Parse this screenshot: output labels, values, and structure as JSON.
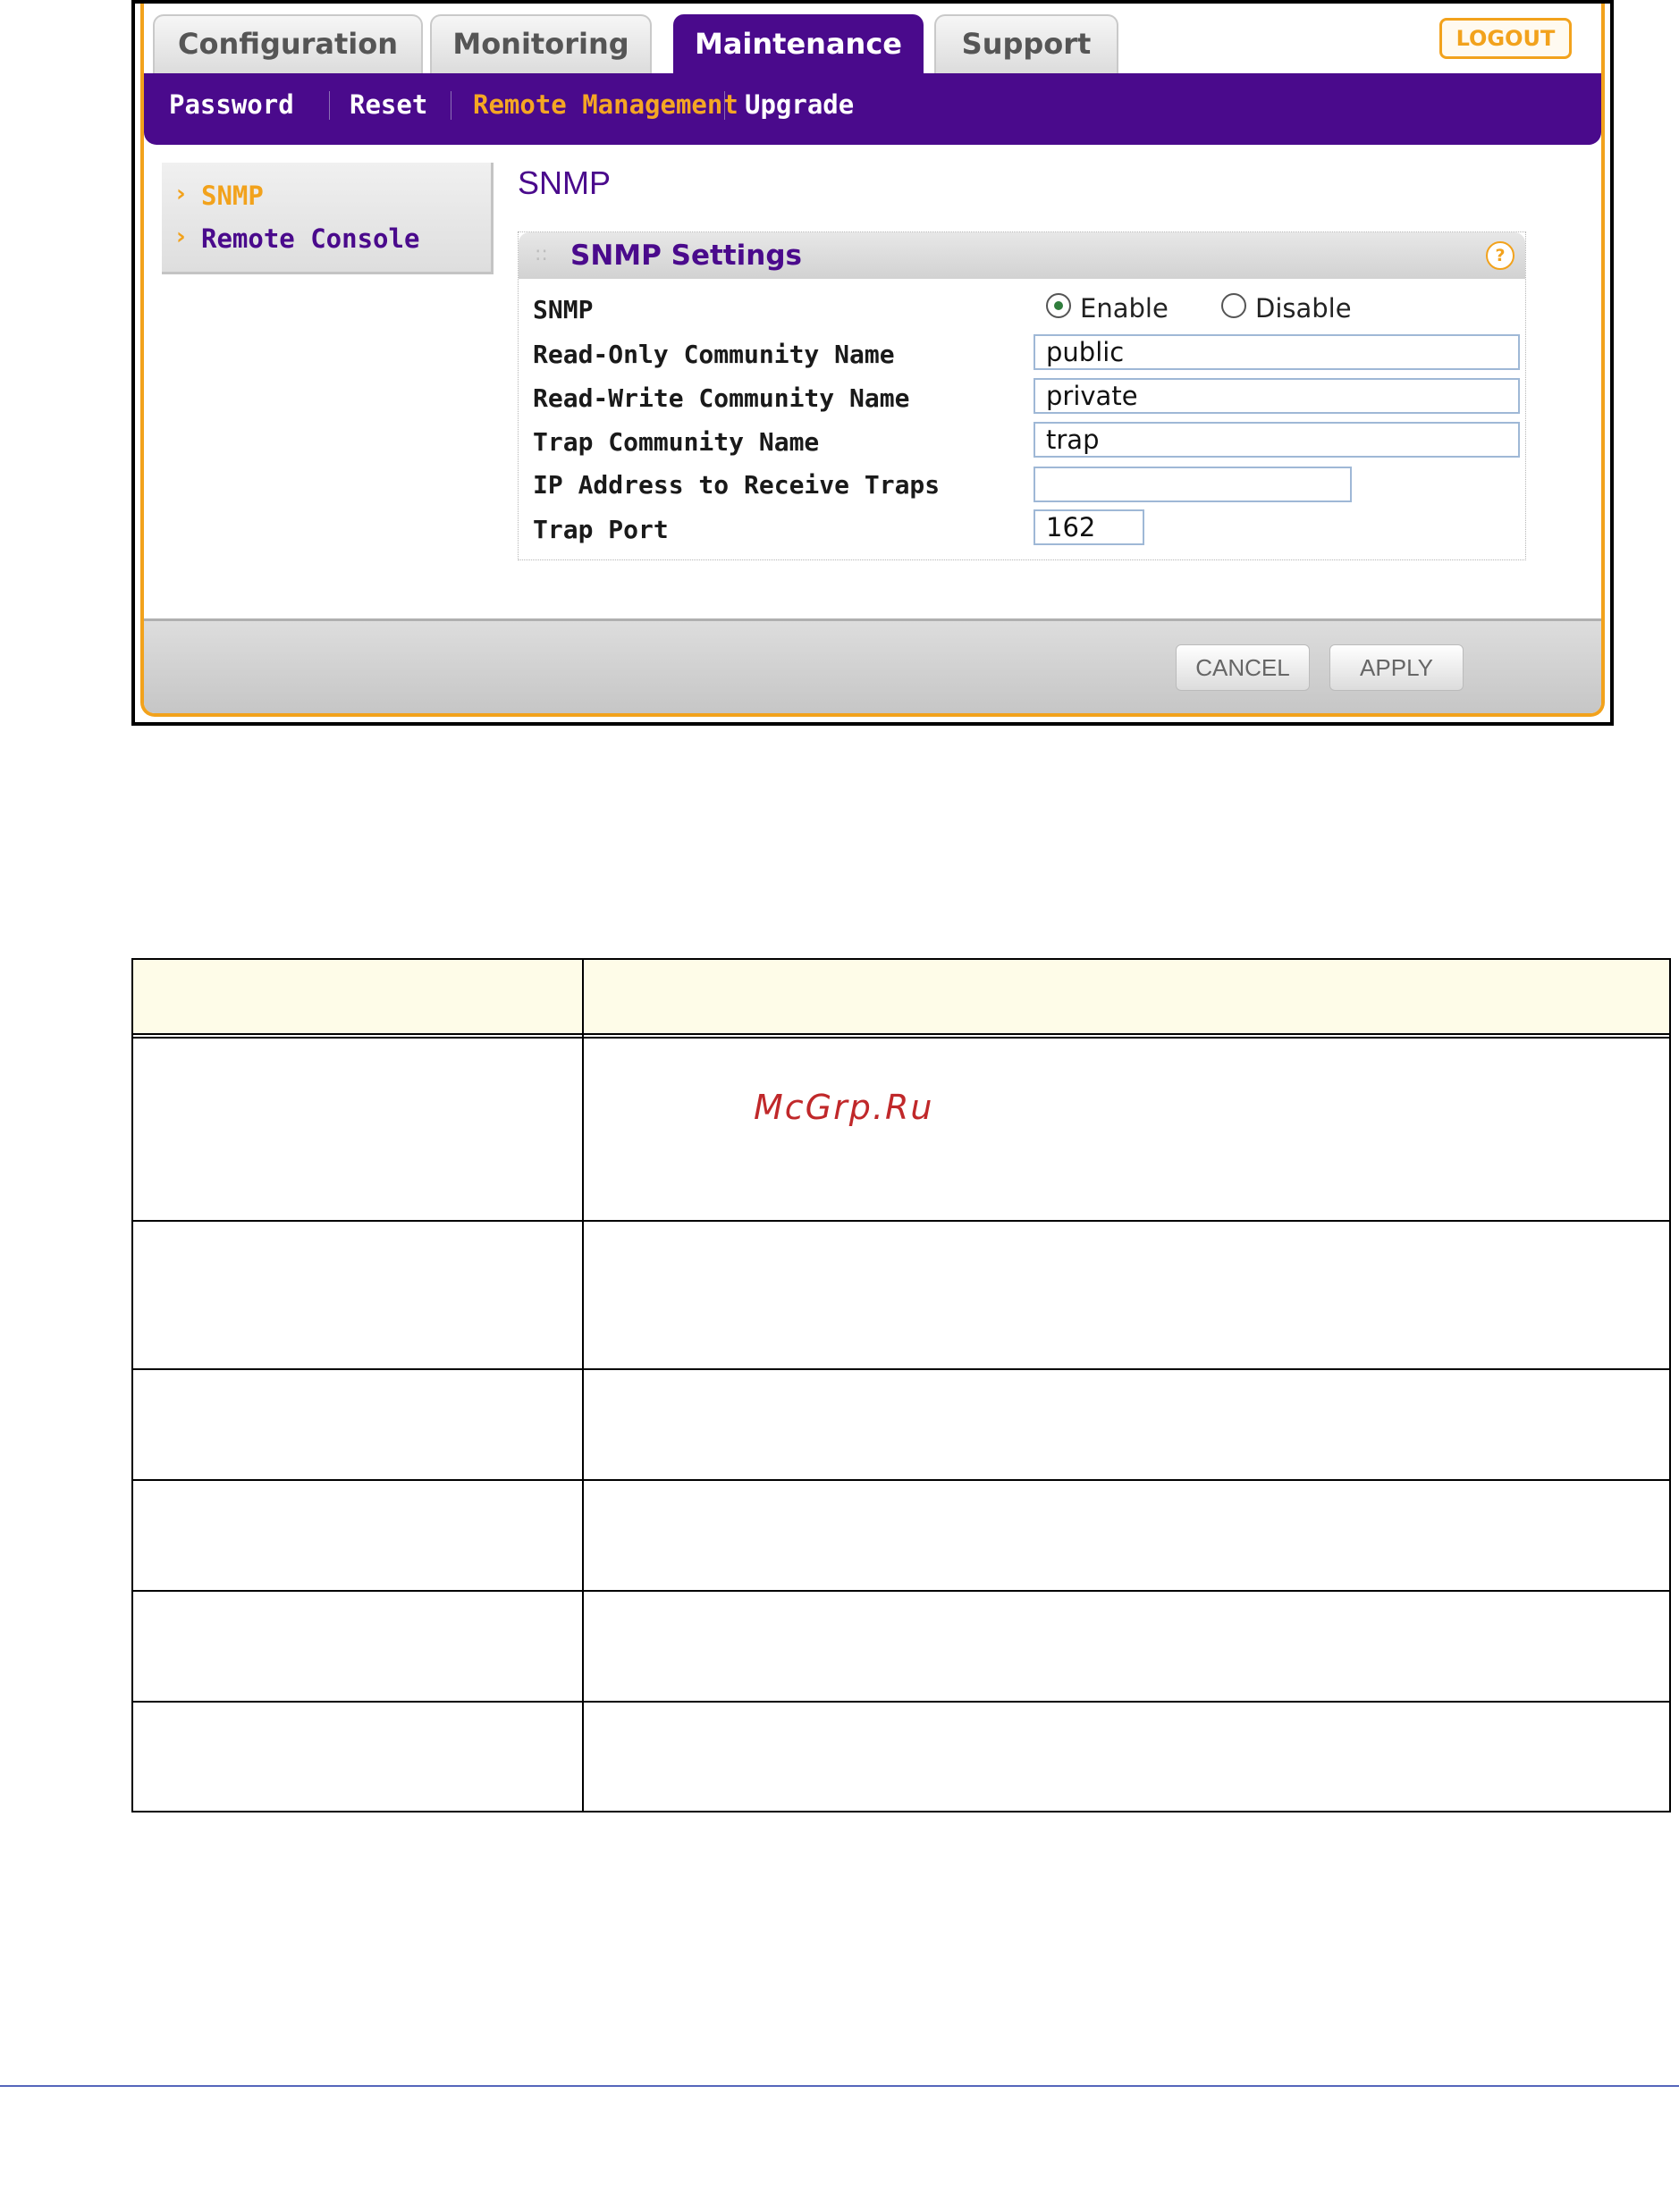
{
  "tabs": [
    {
      "label": "Configuration",
      "active": false
    },
    {
      "label": "Monitoring",
      "active": false
    },
    {
      "label": "Maintenance",
      "active": true
    },
    {
      "label": "Support",
      "active": false
    }
  ],
  "logout_label": "LOGOUT",
  "subnav": [
    {
      "label": "Password",
      "active": false
    },
    {
      "label": "Reset",
      "active": false
    },
    {
      "label": "Remote Management",
      "active": true
    },
    {
      "label": "Upgrade",
      "active": false
    }
  ],
  "sidemenu": [
    {
      "label": "SNMP",
      "active": true
    },
    {
      "label": "Remote Console",
      "active": false
    }
  ],
  "page_title": "SNMP",
  "panel": {
    "title": "SNMP Settings",
    "help_icon": "?",
    "snmp_label": "SNMP",
    "enable_label": "Enable",
    "disable_label": "Disable",
    "snmp_state": "Enable",
    "read_only_label": "Read-Only Community Name",
    "read_only_value": "public",
    "read_write_label": "Read-Write Community Name",
    "read_write_value": "private",
    "trap_label": "Trap Community Name",
    "trap_value": "trap",
    "ip_label": "IP Address to Receive Traps",
    "ip_value": "",
    "port_label": "Trap Port",
    "port_value": "162"
  },
  "buttons": {
    "cancel": "CANCEL",
    "apply": "APPLY"
  },
  "watermark": "McGrp.Ru",
  "colors": {
    "brand_purple": "#4a0a8c",
    "accent_orange": "#f2a21c",
    "table_header_bg": "#fefce8"
  }
}
